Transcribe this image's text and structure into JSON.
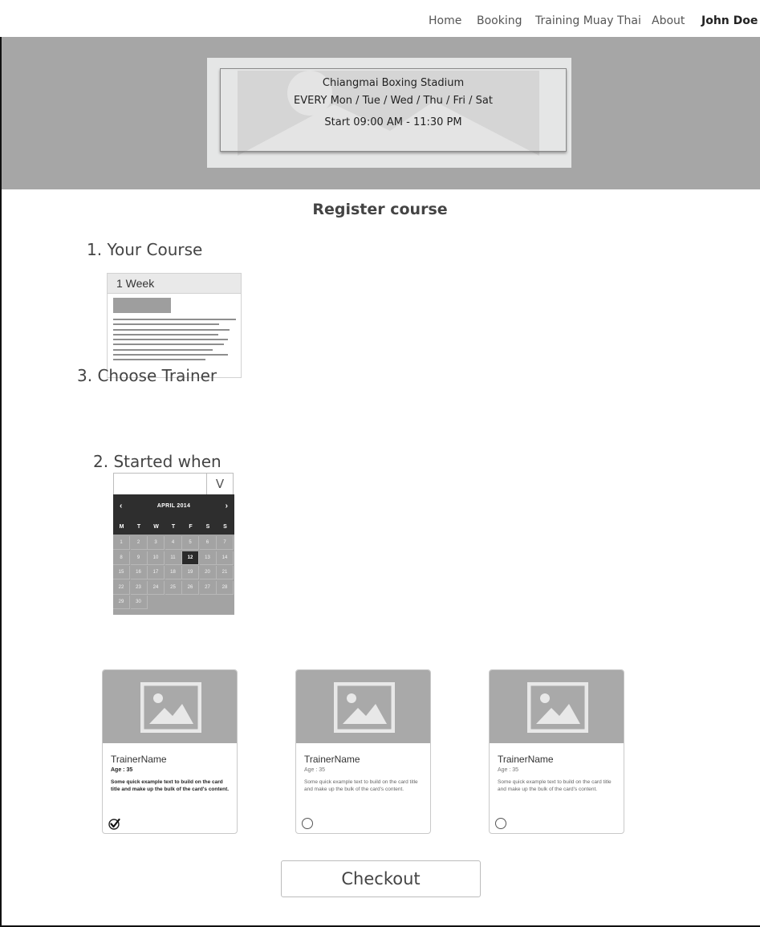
{
  "nav": {
    "items": [
      {
        "label": "Home"
      },
      {
        "label": "Booking"
      },
      {
        "label": "Training Muay Thai"
      },
      {
        "label": "About"
      }
    ],
    "user": "John Doe"
  },
  "hero": {
    "line1": "Chiangmai Boxing Stadium",
    "line2": "EVERY Mon / Tue / Wed / Thu / Fri / Sat",
    "line3": "Start 09:00 AM  -  11:30 PM"
  },
  "page_title": "Register course",
  "steps": {
    "course": "1. Your  Course",
    "date": "2. Started when",
    "trainer": "3. Choose Trainer"
  },
  "course_card": {
    "title": "1 Week"
  },
  "datepicker": {
    "value": "",
    "toggle": "V",
    "month": "APRIL 2014",
    "prev": "‹",
    "next": "›",
    "weekdays": [
      "M",
      "T",
      "W",
      "T",
      "F",
      "S",
      "S"
    ],
    "days": [
      "1",
      "2",
      "3",
      "4",
      "5",
      "6",
      "7",
      "8",
      "9",
      "10",
      "11",
      "12",
      "13",
      "14",
      "15",
      "16",
      "17",
      "18",
      "19",
      "20",
      "21",
      "22",
      "23",
      "24",
      "25",
      "26",
      "27",
      "28",
      "29",
      "30"
    ],
    "selected_day": "12"
  },
  "trainers": [
    {
      "name": "TrainerName",
      "age": "Age : 35",
      "desc": "Some quick example text to build on the card title and make up the bulk of the card's content.",
      "selected": true
    },
    {
      "name": "TrainerName",
      "age": "Age : 35",
      "desc": "Some quick example text to build on the card title and make up the bulk of the card's content.",
      "selected": false
    },
    {
      "name": "TrainerName",
      "age": "Age : 35",
      "desc": "Some quick example text to build on the card title and make up the bulk of the card's content.",
      "selected": false
    }
  ],
  "checkout_label": "Checkout",
  "colors": {
    "hero_bg": "#a6a6a6",
    "calendar_header": "#2e2e2e",
    "calendar_body": "#a3a3a3",
    "placeholder_image": "#a9a9a9"
  }
}
